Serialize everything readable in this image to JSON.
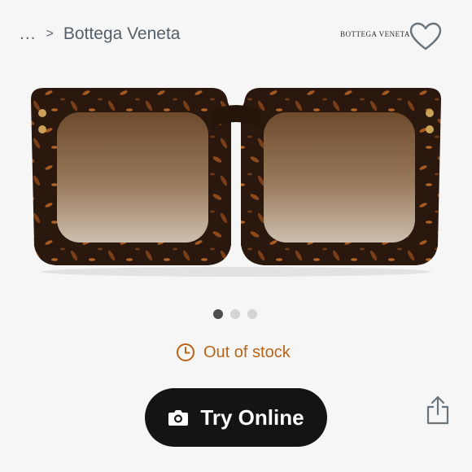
{
  "breadcrumb": {
    "ellipsis": "...",
    "separator": ">",
    "current": "Bottega Veneta"
  },
  "brand_logo_text": "BOTTEGA VENETA",
  "carousel": {
    "total": 3,
    "active_index": 0
  },
  "stock_status": "Out of stock",
  "try_online_label": "Try Online",
  "icons": {
    "favorite": "heart-icon",
    "stock": "clock-icon",
    "camera": "camera-icon",
    "share": "share-icon"
  },
  "colors": {
    "stock": "#b86418",
    "button_bg": "#141414",
    "frame": "#2e1a10",
    "lens": "#7a5a3a"
  }
}
